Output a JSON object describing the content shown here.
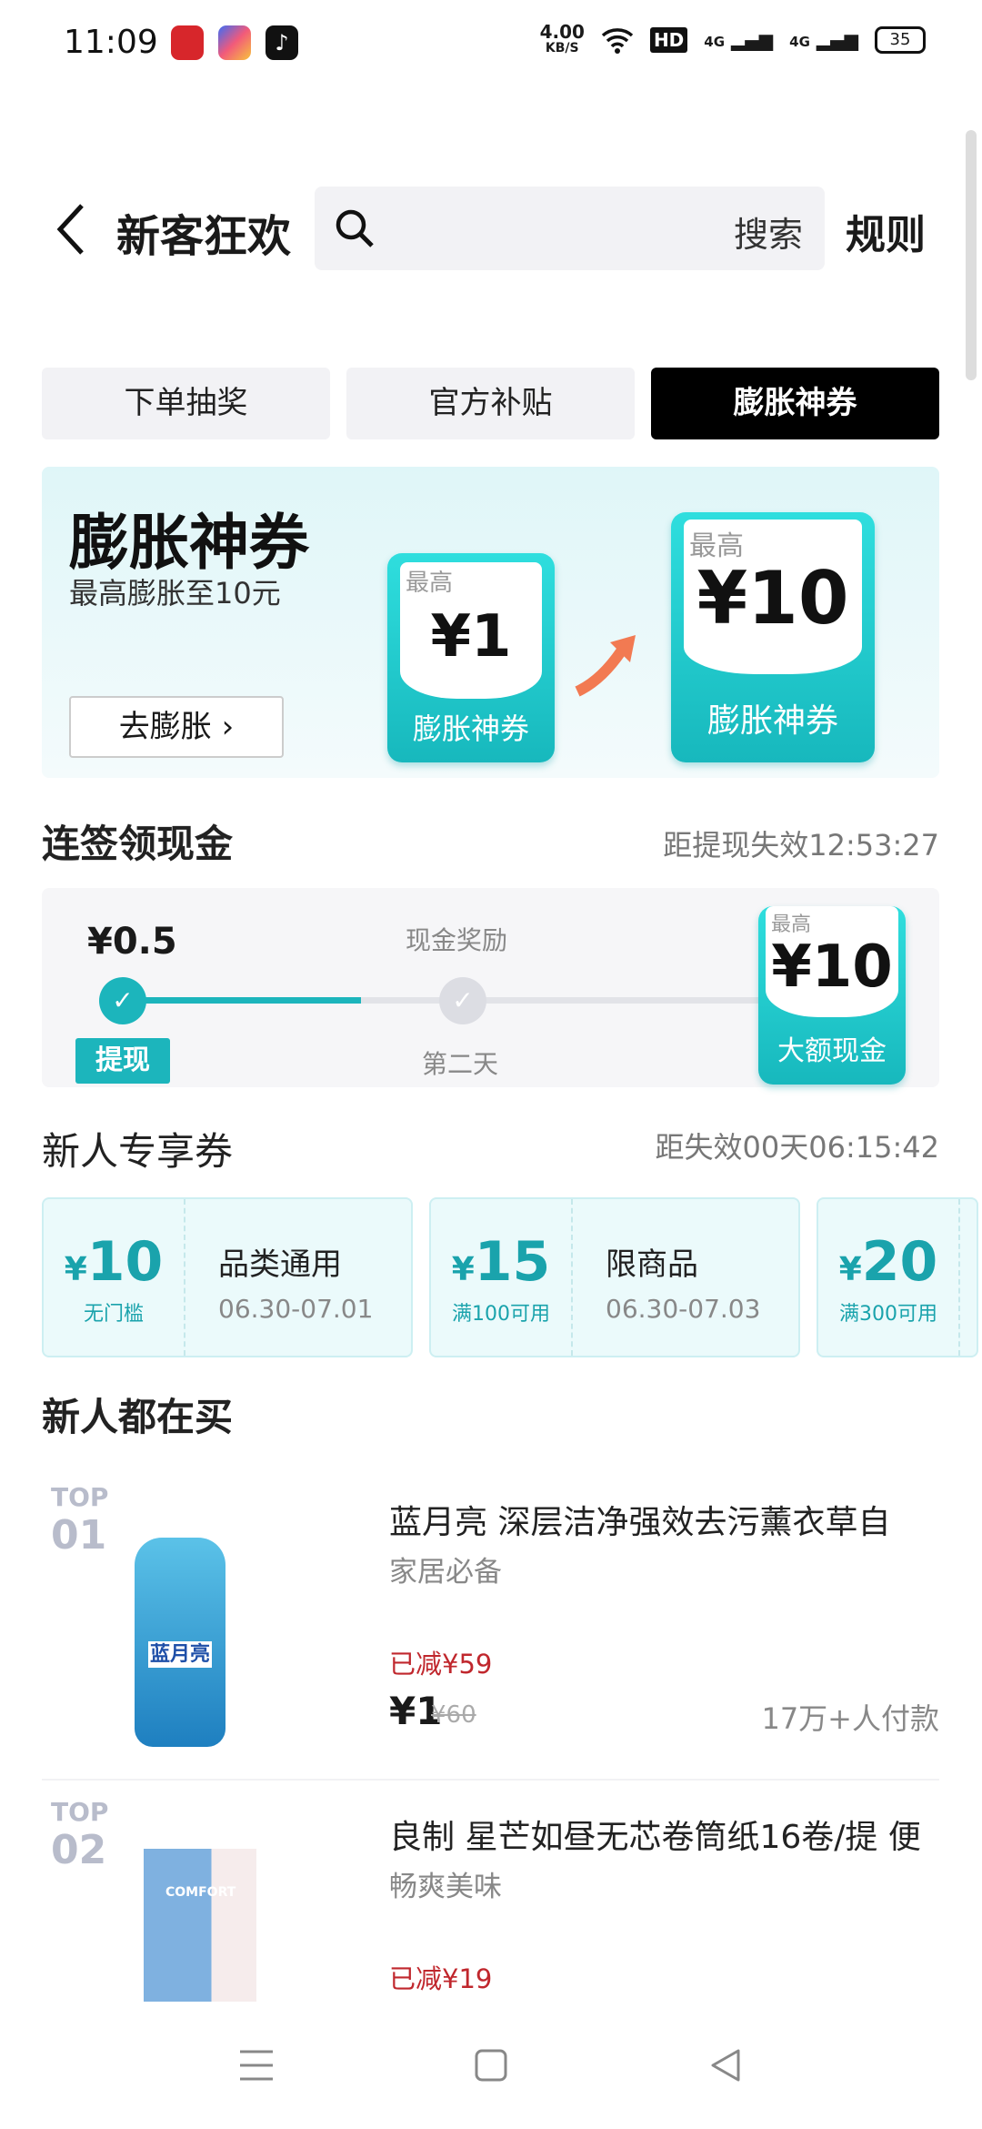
{
  "status_bar": {
    "time": "11:09",
    "net_speed": "4.00",
    "net_unit": "KB/S",
    "hd": "HD",
    "sig1": "4G",
    "sig2": "4G",
    "battery": "35"
  },
  "header": {
    "title": "新客狂欢",
    "search_placeholder": "搜索",
    "rules": "规则"
  },
  "tabs": [
    {
      "label": "下单抽奖",
      "active": false
    },
    {
      "label": "官方补贴",
      "active": false
    },
    {
      "label": "膨胀神券",
      "active": true
    }
  ],
  "banner": {
    "title": "膨胀神券",
    "subtitle": "最高膨胀至10元",
    "button": "去膨胀",
    "card_small": {
      "prefix": "最高",
      "amount": "¥1",
      "label": "膨胀神券"
    },
    "card_big": {
      "prefix": "最高",
      "amount": "¥10",
      "label": "膨胀神券"
    }
  },
  "signin": {
    "title": "连签领现金",
    "countdown": "距提现失效12:53:27",
    "day1_amount": "¥0.5",
    "day1_button": "提现",
    "middle_label": "现金奖励",
    "day2_label": "第二天",
    "grand_prefix": "最高",
    "grand_amount": "¥10",
    "grand_label": "大额现金",
    "progress": 0.33
  },
  "coupons_section": {
    "title": "新人专享券",
    "countdown": "距失效00天06:15:42"
  },
  "coupons": [
    {
      "currency": "¥",
      "amount": "10",
      "condition": "无门槛",
      "name": "品类通用",
      "date": "06.30-07.01"
    },
    {
      "currency": "¥",
      "amount": "15",
      "condition": "满100可用",
      "name": "限商品",
      "date": "06.30-07.03"
    },
    {
      "currency": "¥",
      "amount": "20",
      "condition": "满300可用",
      "name": "",
      "date": ""
    }
  ],
  "products_section": {
    "title": "新人都在买"
  },
  "products": [
    {
      "rank_label": "TOP",
      "rank": "01",
      "title": "蓝月亮 深层洁净强效去污薰衣草自",
      "tag": "家居必备",
      "saved": "已减¥59",
      "price": "¥1",
      "original_price": "¥60",
      "sales": "17万+人付款",
      "image_text": "蓝月亮"
    },
    {
      "rank_label": "TOP",
      "rank": "02",
      "title": "良制 星芒如昼无芯卷筒纸16卷/提 便",
      "tag": "畅爽美味",
      "saved": "已减¥19",
      "image_text": "COMFORT"
    }
  ],
  "colors": {
    "accent": "#1cb5bc",
    "price_red": "#c0272d",
    "tab_active": "#000000"
  }
}
